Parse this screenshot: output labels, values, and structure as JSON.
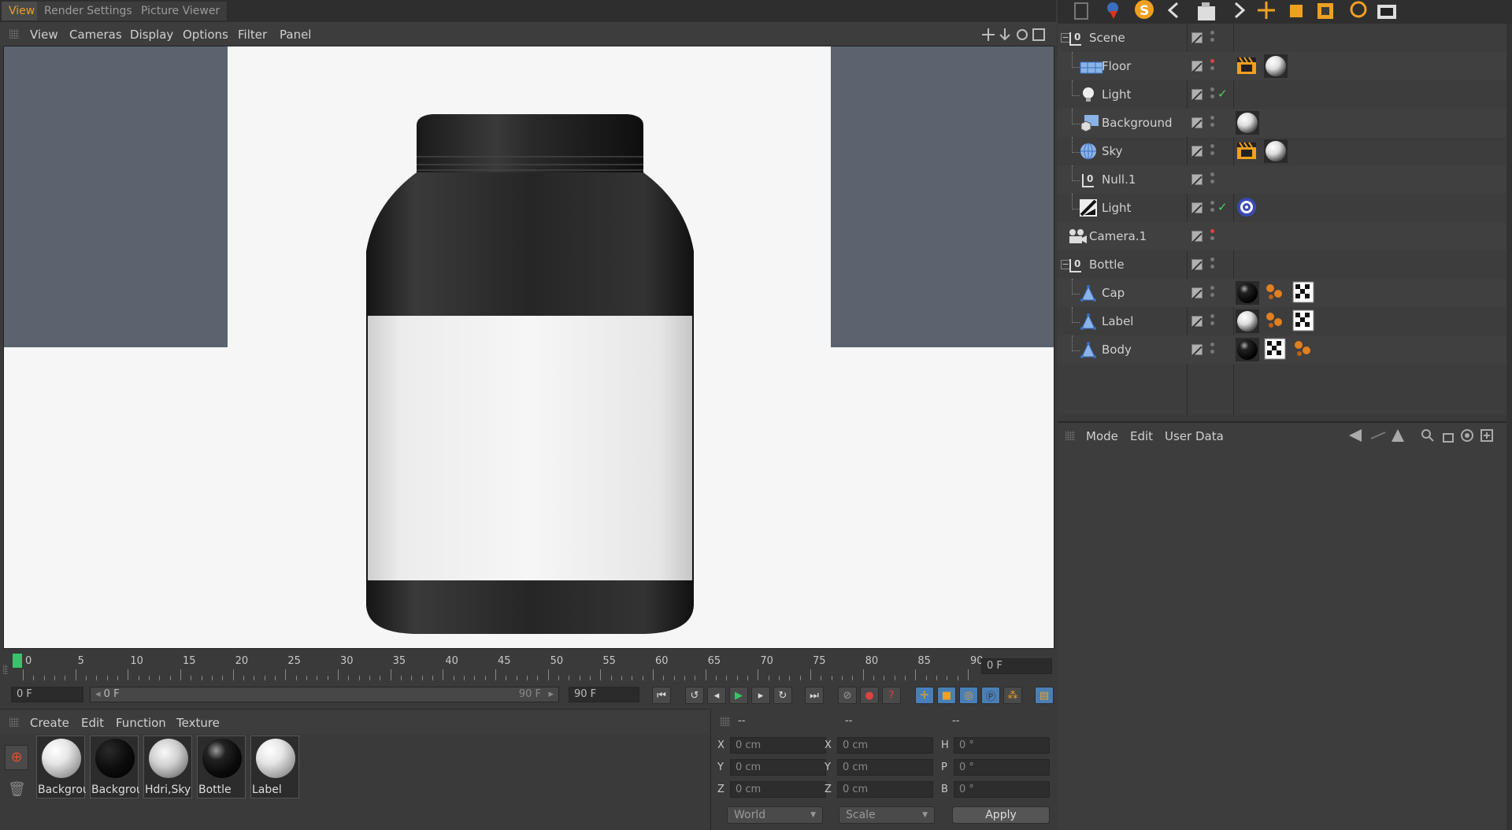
{
  "tabs": [
    "View",
    "Render Settings",
    "Picture Viewer"
  ],
  "viewport_menu": [
    "View",
    "Cameras",
    "Display",
    "Options",
    "Filter",
    "Panel"
  ],
  "timeline": {
    "labels": [
      "0",
      "5",
      "10",
      "15",
      "20",
      "25",
      "30",
      "35",
      "40",
      "45",
      "50",
      "55",
      "60",
      "65",
      "70",
      "75",
      "80",
      "85",
      "90"
    ],
    "current_frame": "0 F",
    "start_field": "0 F",
    "range_start": "0 F",
    "range_end": "90 F",
    "end_field": "90 F"
  },
  "material_menu": [
    "Create",
    "Edit",
    "Function",
    "Texture"
  ],
  "materials": [
    {
      "label": "Backgrou",
      "style": "white"
    },
    {
      "label": "Backgrou",
      "style": "black"
    },
    {
      "label": "Hdri,Sky",
      "style": "hdri"
    },
    {
      "label": "Bottle",
      "style": "dark"
    },
    {
      "label": "Label",
      "style": "white"
    }
  ],
  "coords": {
    "header": [
      "--",
      "--",
      "--"
    ],
    "rows": [
      {
        "a": "X",
        "av": "0 cm",
        "b": "X",
        "bv": "0 cm",
        "c": "H",
        "cv": "0 °"
      },
      {
        "a": "Y",
        "av": "0 cm",
        "b": "Y",
        "bv": "0 cm",
        "c": "P",
        "cv": "0 °"
      },
      {
        "a": "Z",
        "av": "0 cm",
        "b": "Z",
        "bv": "0 cm",
        "c": "B",
        "cv": "0 °"
      }
    ],
    "space": "World",
    "mode": "Scale",
    "apply": "Apply"
  },
  "objects": [
    {
      "name": "Scene",
      "icon": "null-icon",
      "depth": 0,
      "expand": true,
      "check": false,
      "dotred": false
    },
    {
      "name": "Floor",
      "icon": "floor-icon",
      "depth": 1,
      "expand": false,
      "check": false,
      "dotred": true
    },
    {
      "name": "Light",
      "icon": "light-icon",
      "depth": 1,
      "expand": false,
      "check": true,
      "dotred": false
    },
    {
      "name": "Background",
      "icon": "background-icon",
      "depth": 1,
      "expand": false,
      "check": false,
      "dotred": false
    },
    {
      "name": "Sky",
      "icon": "sky-icon",
      "depth": 1,
      "expand": false,
      "check": false,
      "dotred": false
    },
    {
      "name": "Null.1",
      "icon": "null-icon",
      "depth": 1,
      "expand": false,
      "check": false,
      "dotred": false
    },
    {
      "name": "Light",
      "icon": "spotlight-icon",
      "depth": 1,
      "expand": false,
      "check": true,
      "dotred": false
    },
    {
      "name": "Camera.1",
      "icon": "camera-icon",
      "depth": 0,
      "expand": false,
      "check": false,
      "dotred": true
    },
    {
      "name": "Bottle",
      "icon": "null-icon",
      "depth": 0,
      "expand": true,
      "check": false,
      "dotred": false
    },
    {
      "name": "Cap",
      "icon": "polygon-icon",
      "depth": 1,
      "expand": false,
      "check": false,
      "dotred": false
    },
    {
      "name": "Label",
      "icon": "polygon-icon",
      "depth": 1,
      "expand": false,
      "check": false,
      "dotred": false
    },
    {
      "name": "Body",
      "icon": "polygon-icon",
      "depth": 1,
      "expand": false,
      "check": false,
      "dotred": false
    }
  ],
  "attr_menu": [
    "Mode",
    "Edit",
    "User Data"
  ],
  "colors": {
    "accent": "#e8a02a",
    "playhead": "#38c46a",
    "viewport_bg": "#f6f6f6",
    "backdrop": "#5a636e"
  }
}
